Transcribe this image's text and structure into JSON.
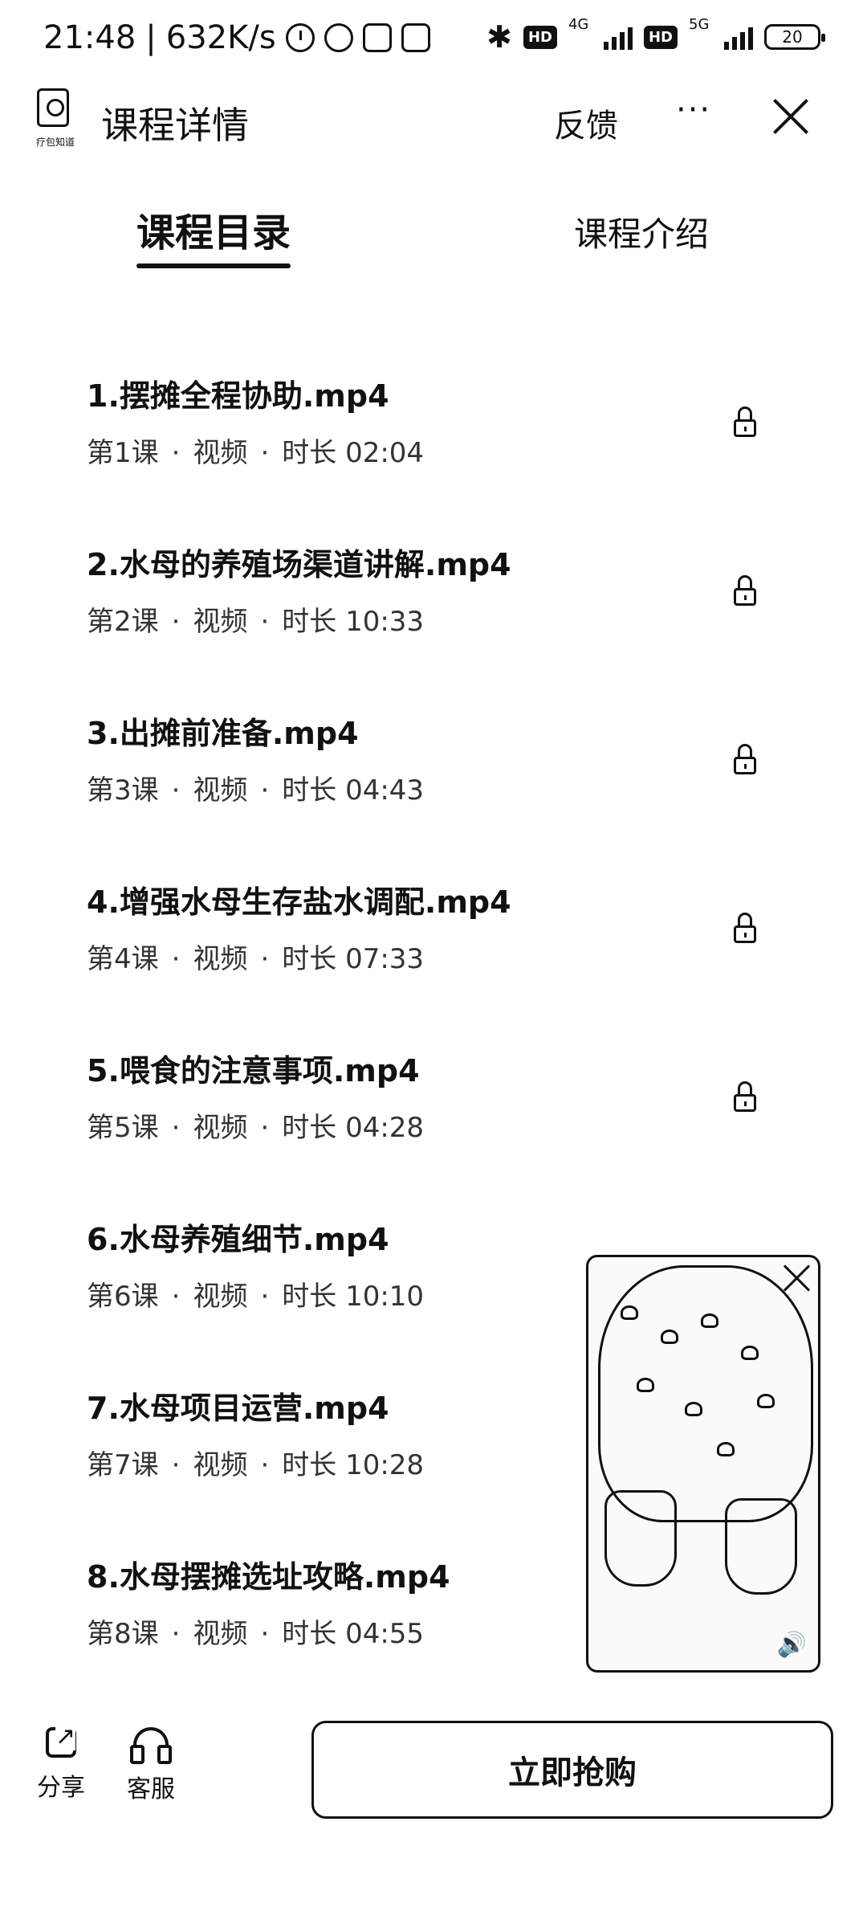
{
  "status_bar": {
    "time": "21:48",
    "separator": "|",
    "net_speed": "632K/s",
    "bluetooth": "✱",
    "hd1": "HD",
    "net1": "4G",
    "hd2": "HD",
    "net2": "5G",
    "battery": "20"
  },
  "header": {
    "logo_text": "疗包知道",
    "title": "课程详情",
    "feedback": "反馈",
    "more": "···"
  },
  "tabs": [
    {
      "label": "课程目录"
    },
    {
      "label": "课程介绍"
    }
  ],
  "lessons": [
    {
      "title": "1.摆摊全程协助.mp4",
      "lesson": "第1课",
      "type": "视频",
      "duration": "时长 02:04"
    },
    {
      "title": "2.水母的养殖场渠道讲解.mp4",
      "lesson": "第2课",
      "type": "视频",
      "duration": "时长 10:33"
    },
    {
      "title": "3.出摊前准备.mp4",
      "lesson": "第3课",
      "type": "视频",
      "duration": "时长 04:43"
    },
    {
      "title": "4.增强水母生存盐水调配.mp4",
      "lesson": "第4课",
      "type": "视频",
      "duration": "时长 07:33"
    },
    {
      "title": "5.喂食的注意事项.mp4",
      "lesson": "第5课",
      "type": "视频",
      "duration": "时长 04:28"
    },
    {
      "title": "6.水母养殖细节.mp4",
      "lesson": "第6课",
      "type": "视频",
      "duration": "时长 10:10"
    },
    {
      "title": "7.水母项目运营.mp4",
      "lesson": "第7课",
      "type": "视频",
      "duration": "时长 10:28"
    },
    {
      "title": "8.水母摆摊选址攻略.mp4",
      "lesson": "第8课",
      "type": "视频",
      "duration": "时长 04:55"
    }
  ],
  "meta_dot": "·",
  "bottom": {
    "share": "分享",
    "service": "客服",
    "buy": "立即抢购"
  }
}
